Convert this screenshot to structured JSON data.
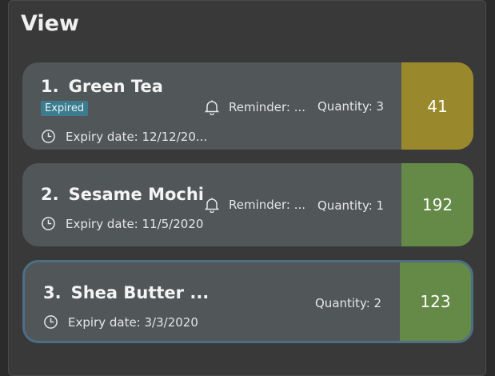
{
  "view": {
    "title": "View"
  },
  "items": [
    {
      "index": "1.",
      "name": "Green Tea",
      "tag": "Expired",
      "expiry": "Expiry date: 12/12/20...",
      "reminder": "Reminder: ...",
      "quantity": "Quantity: 3",
      "count": "41",
      "color": "#9a892c"
    },
    {
      "index": "2.",
      "name": "Sesame Mochi",
      "expiry": "Expiry date: 11/5/2020",
      "reminder": "Reminder: ...",
      "quantity": "Quantity: 1",
      "count": "192",
      "color": "#658a47"
    },
    {
      "index": "3.",
      "name": "Shea Butter ...",
      "expiry": "Expiry date: 3/3/2020",
      "quantity": "Quantity: 2",
      "count": "123",
      "color": "#658a47"
    }
  ],
  "icons": {
    "clock": "clock-icon",
    "bell": "bell-icon"
  },
  "colors": {
    "selected_border": "#4e6e86",
    "card_bg": "#515658",
    "expired_tag": "#3d7b8e"
  }
}
